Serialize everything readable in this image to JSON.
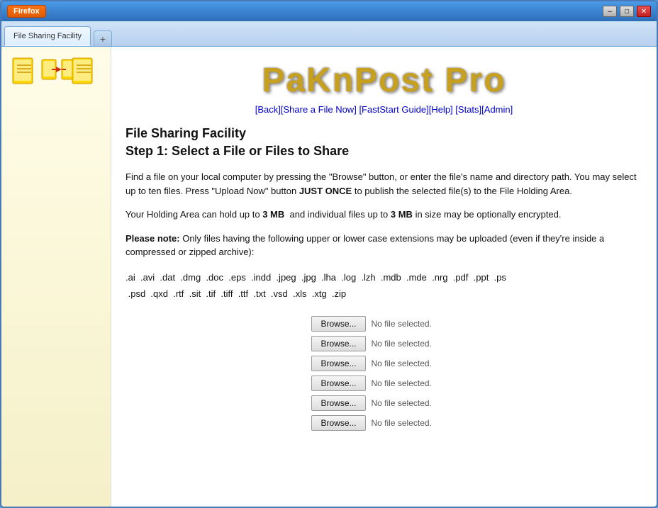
{
  "browser": {
    "title": "File Sharing Facility",
    "firefox_label": "Firefox",
    "tab_label": "File Sharing Facility",
    "tab_new_symbol": "+",
    "win_minimize": "–",
    "win_restore": "□",
    "win_close": "✕"
  },
  "logo": {
    "text": "PaKnPost Pro"
  },
  "nav": {
    "links": [
      {
        "label": "[Back]",
        "href": "#"
      },
      {
        "label": "[Share a File Now]",
        "href": "#"
      },
      {
        "label": "[FastStart Guide]",
        "href": "#"
      },
      {
        "label": "[Help]",
        "href": "#"
      },
      {
        "label": "[Stats]",
        "href": "#"
      },
      {
        "label": "[Admin]",
        "href": "#"
      }
    ]
  },
  "page": {
    "title": "File Sharing Facility",
    "subtitle": "Step 1: Select a File or Files to Share",
    "para1": "Find a file on your local computer by pressing the \"Browse\" button, or enter the file's name and directory path. You may select up to ten files. Press \"Upload Now\" button JUST ONCE to publish the selected file(s) to the File Holding Area.",
    "para1_bold": "JUST ONCE",
    "para2_prefix": "Your Holding Area can hold up to ",
    "para2_bold1": "3 MB",
    "para2_middle": " and individual files up to ",
    "para2_bold2": "3 MB",
    "para2_suffix": " in size may be optionally encrypted.",
    "para3_bold": "Please note:",
    "para3_suffix": " Only files having the following upper or lower case extensions may be uploaded (even if they're inside a compressed or zipped archive):",
    "extensions": ".ai  .avi  .dat  .dmg  .doc  .eps  .indd  .jpeg  .jpg  .lha  .log  .lzh  .mdb  .mde  .nrg  .pdf  .ppt  .ps  .psd  .qxd  .rtf  .sit  .tif  .tiff  .ttf  .txt  .vsd  .xls  .xtg  .zip",
    "browse_label": "Browse...",
    "file_placeholder": "No file selected.",
    "file_rows": [
      {
        "id": 1
      },
      {
        "id": 2
      },
      {
        "id": 3
      },
      {
        "id": 4
      },
      {
        "id": 5
      },
      {
        "id": 6
      }
    ]
  }
}
